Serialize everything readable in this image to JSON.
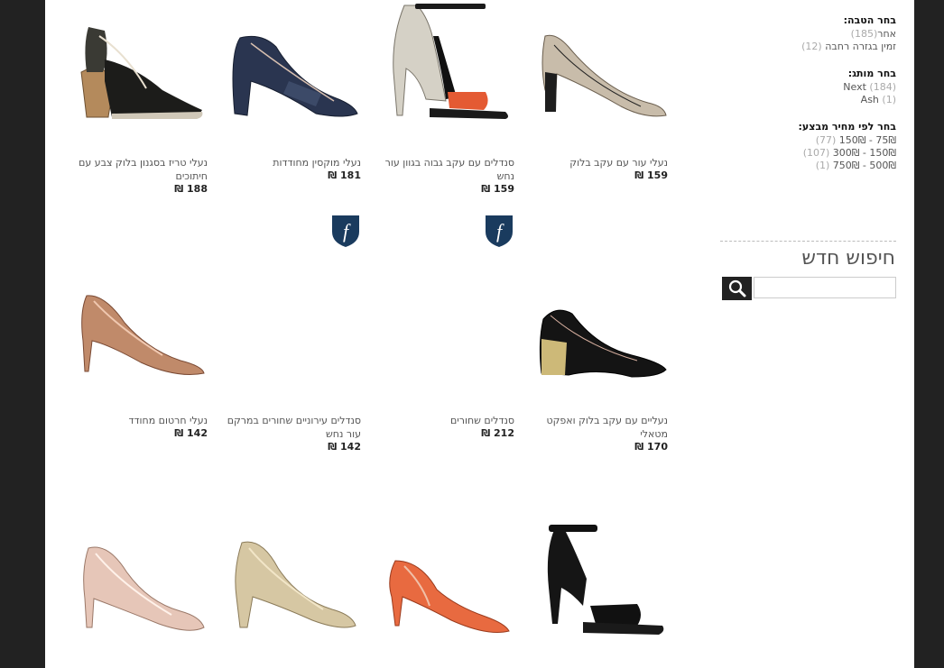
{
  "filters": {
    "brand_title": "בחר הטבה:",
    "brand_items": [
      {
        "label": "אחר",
        "count": "(185)"
      },
      {
        "label": "זמין בגזרה רחבה",
        "count": "(12)"
      }
    ],
    "label_title": "בחר מותג:",
    "label_items": [
      {
        "label": "Next",
        "count": "(184)"
      },
      {
        "label": "Ash",
        "count": "(1)"
      }
    ],
    "price_title": "בחר לפי מחיר מבצע:",
    "price_items": [
      {
        "from": "75₪",
        "to": "150₪",
        "count": "(77)"
      },
      {
        "from": "150₪",
        "to": "300₪",
        "count": "(107)"
      },
      {
        "from": "500₪",
        "to": "750₪",
        "count": "(1)"
      }
    ],
    "price_sep": " - "
  },
  "search": {
    "title": "חיפוש חדש",
    "placeholder": ""
  },
  "colors": {
    "badge_blue": "#1a3b5e",
    "background": "#222222"
  },
  "products": [
    {
      "name": "נעלי עור עם עקב בלוק",
      "price": "159 ₪"
    },
    {
      "name": "סנדלים עם עקב גבוה בגוון עור נחש",
      "price": "159 ₪"
    },
    {
      "name": "נעלי מוקסין מחודדות",
      "price": "181 ₪"
    },
    {
      "name": "נעלי טריז בסגנון בלוק צבע עם חיתוכים",
      "price": "188 ₪"
    },
    {
      "name": "נעליים עם עקב בלוק ואפקט מטאלי",
      "price": "170 ₪"
    },
    {
      "name": "סנדלים שחורים",
      "price": "212 ₪"
    },
    {
      "name": "סנדלים עירוניים שחורים במרקם עור נחש",
      "price": "142 ₪"
    },
    {
      "name": "נעלי חרטום מחודד",
      "price": "142 ₪"
    }
  ],
  "badges": [
    {
      "icon": "f-logo-icon"
    },
    {
      "icon": "f-logo-icon"
    }
  ]
}
